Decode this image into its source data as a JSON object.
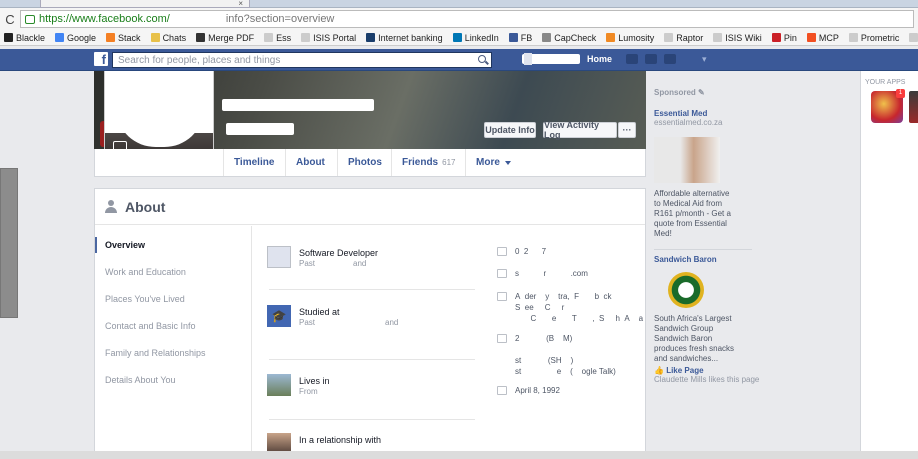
{
  "browser": {
    "tab_close": "×",
    "reload": "C",
    "url_host": "https://www.facebook.com/",
    "url_path": "info?section=overview",
    "bookmarks": [
      {
        "label": "Blackle",
        "color": "#222222"
      },
      {
        "label": "Google",
        "color": "#4285f4"
      },
      {
        "label": "Stack",
        "color": "#f48024"
      },
      {
        "label": "Chats",
        "color": "#e8c14a"
      },
      {
        "label": "Merge PDF",
        "color": "#333333"
      },
      {
        "label": "Ess",
        "color": "#cccccc"
      },
      {
        "label": "ISIS Portal",
        "color": "#cccccc"
      },
      {
        "label": "Internet banking",
        "color": "#1a3e6b"
      },
      {
        "label": "LinkedIn",
        "color": "#0077b5"
      },
      {
        "label": "FB",
        "color": "#3b5998"
      },
      {
        "label": "CapCheck",
        "color": "#888888"
      },
      {
        "label": "Lumosity",
        "color": "#f08a24"
      },
      {
        "label": "Raptor",
        "color": "#cccccc"
      },
      {
        "label": "ISIS Wiki",
        "color": "#cccccc"
      },
      {
        "label": "Pin",
        "color": "#cb2027"
      },
      {
        "label": "MCP",
        "color": "#f25022"
      },
      {
        "label": "Prometric",
        "color": "#cccccc"
      },
      {
        "label": "Satrix",
        "color": "#cccccc"
      },
      {
        "label": "Skrill",
        "color": "#862165"
      },
      {
        "label": "GC",
        "color": "#2a8b2a"
      }
    ]
  },
  "fb": {
    "logo": "f",
    "search_placeholder": "Search for people, places and things",
    "home": "Home"
  },
  "profile": {
    "update_info": "Update Info",
    "view_activity": "View Activity Log",
    "more_dots": "···",
    "tabs": [
      {
        "label": "Timeline",
        "count": ""
      },
      {
        "label": "About",
        "count": ""
      },
      {
        "label": "Photos",
        "count": ""
      },
      {
        "label": "Friends",
        "count": "617"
      },
      {
        "label": "More",
        "count": ""
      }
    ]
  },
  "about": {
    "title": "About",
    "nav": [
      "Overview",
      "Work and Education",
      "Places You've Lived",
      "Contact and Basic Info",
      "Family and Relationships",
      "Details About You"
    ],
    "entries": [
      {
        "title": "Software Developer",
        "sub": "Past",
        "sub2": "and"
      },
      {
        "title": "Studied at",
        "sub": "Past",
        "sub2": "and"
      },
      {
        "title": "Lives in",
        "sub": "From",
        "sub2": ""
      },
      {
        "title": "In a relationship with",
        "sub": "",
        "sub2": ""
      }
    ],
    "contact": [
      {
        "lines": [
          "0  2      7"
        ]
      },
      {
        "lines": [
          "s           r           .com"
        ]
      },
      {
        "lines": [
          "A  der    y    tra,  F       b  ck",
          "S  ee     C     r",
          "       C       e       T       ,  S     h  A    a"
        ]
      },
      {
        "lines": [
          "2            (B    M)",
          "                                 ",
          "st            (SH    )",
          "st                e    (    ogle Talk)"
        ]
      },
      {
        "lines": [
          "April 8, 1992"
        ]
      }
    ]
  },
  "sidebar": {
    "sponsored": "Sponsored",
    "ad1": {
      "title": "Essential Med",
      "url": "essentialmed.co.za",
      "text": "Affordable alternative to Medical Aid from R161 p/month - Get a quote from Essential Med!"
    },
    "ad2": {
      "title": "Sandwich Baron",
      "text": "South Africa's Largest Sandwich Group Sandwich Baron produces fresh snacks and sandwiches...",
      "like": "Like Page",
      "social": "Claudette Mills likes this page"
    },
    "your_apps": "YOUR APPS",
    "app_badge": "1"
  }
}
